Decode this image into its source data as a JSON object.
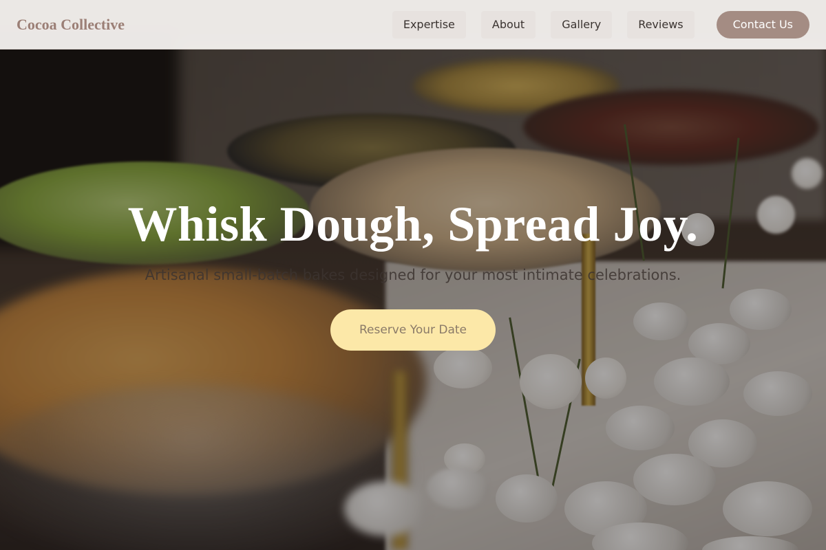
{
  "nav": {
    "brand": "Cocoa Collective",
    "links": [
      "Expertise",
      "About",
      "Gallery",
      "Reviews"
    ],
    "contact": "Contact Us"
  },
  "hero": {
    "headline": "Whisk Dough, Spread Joy.",
    "subline": "Artisanal small-batch bakes designed for your most intimate celebrations.",
    "cta": "Reserve Your Date"
  },
  "colors": {
    "brand": "#9b7f76",
    "contact_button": "#a48c83",
    "cta_button": "#fce8a8",
    "nav_background": "#f4f0ee"
  }
}
